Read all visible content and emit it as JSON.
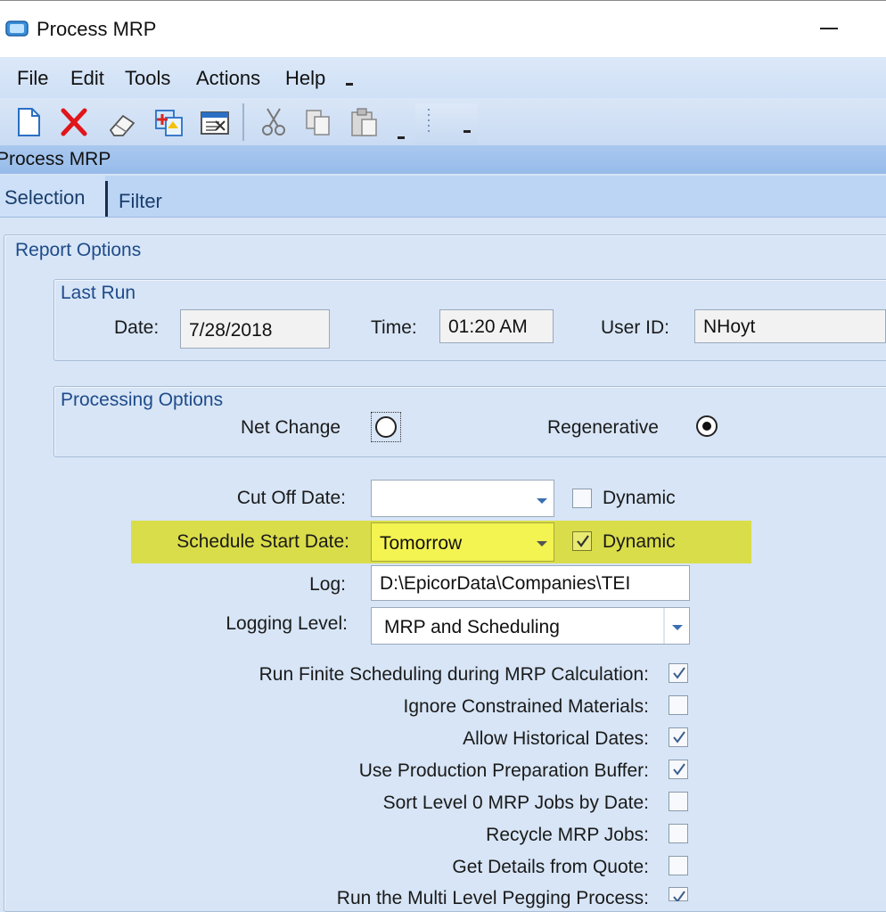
{
  "window": {
    "title": "Process MRP"
  },
  "menu": {
    "items": [
      "File",
      "Edit",
      "Tools",
      "Actions",
      "Help"
    ]
  },
  "toolbar": {
    "icons": [
      "new-icon",
      "delete-icon",
      "clear-icon",
      "attach-icon",
      "print-preview-icon",
      "cut-icon",
      "copy-icon",
      "paste-icon"
    ]
  },
  "panel": {
    "title": "Process MRP"
  },
  "tabs": [
    {
      "label": "Selection",
      "active": true
    },
    {
      "label": "Filter",
      "active": false
    }
  ],
  "report_options": {
    "label": "Report Options",
    "last_run": {
      "label": "Last Run",
      "date_label": "Date:",
      "date_value": "7/28/2018",
      "time_label": "Time:",
      "time_value": "01:20 AM",
      "user_label": "User ID:",
      "user_value": "NHoyt"
    },
    "processing": {
      "label": "Processing Options",
      "net_change_label": "Net Change",
      "net_change_selected": false,
      "regenerative_label": "Regenerative",
      "regenerative_selected": true
    },
    "cut_off": {
      "label": "Cut Off Date:",
      "value": "",
      "dynamic_label": "Dynamic",
      "dynamic_checked": false
    },
    "schedule_start": {
      "label": "Schedule Start Date:",
      "value": "Tomorrow",
      "dynamic_label": "Dynamic",
      "dynamic_checked": true,
      "highlight_color": "#dadd4a"
    },
    "log": {
      "label": "Log:",
      "value": "D:\\EpicorData\\Companies\\TEI"
    },
    "logging_level": {
      "label": "Logging Level:",
      "value": "MRP and Scheduling"
    },
    "checkboxes": [
      {
        "label": "Run Finite Scheduling during MRP Calculation:",
        "checked": true
      },
      {
        "label": "Ignore Constrained Materials:",
        "checked": false
      },
      {
        "label": "Allow Historical Dates:",
        "checked": true
      },
      {
        "label": "Use Production Preparation Buffer:",
        "checked": true
      },
      {
        "label": "Sort Level 0 MRP Jobs by Date:",
        "checked": false
      },
      {
        "label": "Recycle MRP Jobs:",
        "checked": false
      },
      {
        "label": "Get Details from Quote:",
        "checked": false
      },
      {
        "label": "Run the Multi Level Pegging Process:",
        "checked": true
      }
    ]
  },
  "colors": {
    "accent": "#1f4b8a",
    "header": "#a9c8ef",
    "background": "#d7e5f6"
  }
}
